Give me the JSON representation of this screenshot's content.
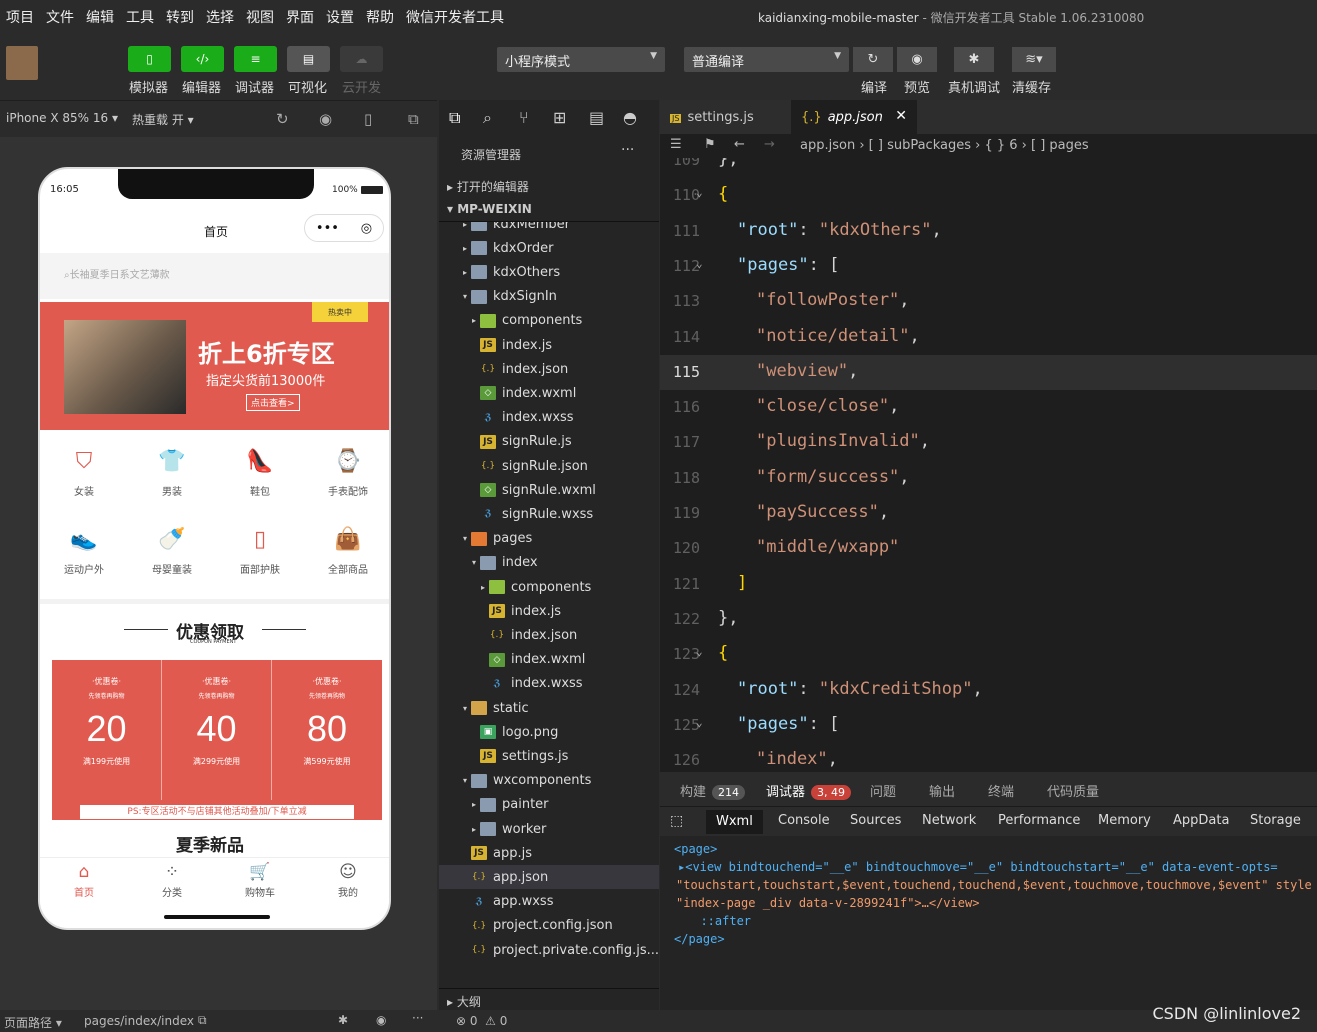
{
  "menu": [
    "项目",
    "文件",
    "编辑",
    "工具",
    "转到",
    "选择",
    "视图",
    "界面",
    "设置",
    "帮助",
    "微信开发者工具"
  ],
  "window_title": {
    "project": "kaidianxing-mobile-master",
    "sep": " - ",
    "app": "微信开发者工具 Stable 1.06.2310080"
  },
  "toolbar": {
    "simulator": "模拟器",
    "editor": "编辑器",
    "debugger": "调试器",
    "visual": "可视化",
    "cloud": "云开发",
    "mode_select": "小程序模式",
    "compile_select": "普通编译",
    "compile": "编译",
    "preview": "预览",
    "real_debug": "真机调试",
    "clear_cache": "清缓存"
  },
  "simbar": {
    "device": "iPhone X 85% 16",
    "hot_reload": "热重载 开"
  },
  "phone": {
    "time": "16:05",
    "battery": "100%",
    "page_title": "首页",
    "search_placeholder": "长袖夏季日系文艺薄款",
    "banner": {
      "tag": "热卖中",
      "title": "折上6折专区",
      "subtitle": "指定尖货前13000件",
      "button": "点击查看>"
    },
    "categories": [
      {
        "icon": "skirt-icon",
        "label": "女装"
      },
      {
        "icon": "shirt-icon",
        "label": "男装"
      },
      {
        "icon": "heel-icon",
        "label": "鞋包"
      },
      {
        "icon": "watch-icon",
        "label": "手表配饰"
      },
      {
        "icon": "sneaker-icon",
        "label": "运动户外"
      },
      {
        "icon": "bottle-icon",
        "label": "母婴童装"
      },
      {
        "icon": "cosmetic-icon",
        "label": "面部护肤"
      },
      {
        "icon": "bag-icon",
        "label": "全部商品"
      }
    ],
    "coupon_title": "优惠领取",
    "coupon_sub": "COUPON PAYMENT",
    "coupons": [
      {
        "tag": "·优惠卷·",
        "desc": "先领卷再购物",
        "value": "20",
        "cond": "满199元使用"
      },
      {
        "tag": "·优惠卷·",
        "desc": "先领卷再购物",
        "value": "40",
        "cond": "满299元使用"
      },
      {
        "tag": "·优惠卷·",
        "desc": "先领卷再购物",
        "value": "80",
        "cond": "满599元使用"
      }
    ],
    "coupon_note": "PS:专区活动不与店铺其他活动叠加/下单立减",
    "new_title": "夏季新品",
    "tabbar": [
      {
        "icon": "home-icon",
        "label": "首页"
      },
      {
        "icon": "category-icon",
        "label": "分类"
      },
      {
        "icon": "cart-icon",
        "label": "购物车"
      },
      {
        "icon": "user-icon",
        "label": "我的"
      }
    ]
  },
  "explorer": {
    "title": "资源管理器",
    "open_editors": "打开的编辑器",
    "root": "MP-WEIXIN",
    "outline": "大纲",
    "tree": [
      {
        "d": 1,
        "arr": "▸",
        "type": "folder",
        "name": "kdxMember"
      },
      {
        "d": 1,
        "arr": "▸",
        "type": "folder",
        "name": "kdxOrder"
      },
      {
        "d": 1,
        "arr": "▸",
        "type": "folder",
        "name": "kdxOthers"
      },
      {
        "d": 1,
        "arr": "▾",
        "type": "folder",
        "name": "kdxSignIn"
      },
      {
        "d": 2,
        "arr": "▸",
        "type": "folder green",
        "name": "components"
      },
      {
        "d": 2,
        "arr": "",
        "type": "js",
        "name": "index.js"
      },
      {
        "d": 2,
        "arr": "",
        "type": "json",
        "name": "index.json"
      },
      {
        "d": 2,
        "arr": "",
        "type": "wxml",
        "name": "index.wxml"
      },
      {
        "d": 2,
        "arr": "",
        "type": "wxss",
        "name": "index.wxss"
      },
      {
        "d": 2,
        "arr": "",
        "type": "js",
        "name": "signRule.js"
      },
      {
        "d": 2,
        "arr": "",
        "type": "json",
        "name": "signRule.json"
      },
      {
        "d": 2,
        "arr": "",
        "type": "wxml",
        "name": "signRule.wxml"
      },
      {
        "d": 2,
        "arr": "",
        "type": "wxss",
        "name": "signRule.wxss"
      },
      {
        "d": 1,
        "arr": "▾",
        "type": "folder orange",
        "name": "pages"
      },
      {
        "d": 2,
        "arr": "▾",
        "type": "folder",
        "name": "index"
      },
      {
        "d": 3,
        "arr": "▸",
        "type": "folder green",
        "name": "components"
      },
      {
        "d": 3,
        "arr": "",
        "type": "js",
        "name": "index.js"
      },
      {
        "d": 3,
        "arr": "",
        "type": "json",
        "name": "index.json"
      },
      {
        "d": 3,
        "arr": "",
        "type": "wxml",
        "name": "index.wxml"
      },
      {
        "d": 3,
        "arr": "",
        "type": "wxss",
        "name": "index.wxss"
      },
      {
        "d": 1,
        "arr": "▾",
        "type": "folder yel",
        "name": "static"
      },
      {
        "d": 2,
        "arr": "",
        "type": "png",
        "name": "logo.png"
      },
      {
        "d": 2,
        "arr": "",
        "type": "js",
        "name": "settings.js"
      },
      {
        "d": 1,
        "arr": "▾",
        "type": "folder",
        "name": "wxcomponents"
      },
      {
        "d": 2,
        "arr": "▸",
        "type": "folder",
        "name": "painter"
      },
      {
        "d": 2,
        "arr": "▸",
        "type": "folder",
        "name": "worker"
      },
      {
        "d": 1,
        "arr": "",
        "type": "js",
        "name": "app.js"
      },
      {
        "d": 1,
        "arr": "",
        "type": "json",
        "name": "app.json",
        "selected": true
      },
      {
        "d": 1,
        "arr": "",
        "type": "wxss",
        "name": "app.wxss"
      },
      {
        "d": 1,
        "arr": "",
        "type": "json",
        "name": "project.config.json"
      },
      {
        "d": 1,
        "arr": "",
        "type": "json",
        "name": "project.private.config.js..."
      }
    ]
  },
  "editor": {
    "tabs": [
      {
        "name": "settings.js",
        "icon": "JS"
      },
      {
        "name": "app.json",
        "icon": "{ }",
        "active": true
      }
    ],
    "breadcrumb": [
      "app.json",
      "[ ] subPackages",
      "{ } 6",
      "[ ] pages"
    ],
    "lines": [
      {
        "n": "109",
        "indent": 2,
        "text": "},",
        "cls": "p"
      },
      {
        "n": "110",
        "indent": 2,
        "text": "{",
        "cls": "br",
        "fold": true
      },
      {
        "n": "111",
        "indent": 3,
        "key": "\"root\"",
        "val": "\"kdxOthers\"",
        "tail": ","
      },
      {
        "n": "112",
        "indent": 3,
        "key": "\"pages\"",
        "tail": ": [",
        "fold": true
      },
      {
        "n": "113",
        "indent": 4,
        "val": "\"followPoster\"",
        "tail": ","
      },
      {
        "n": "114",
        "indent": 4,
        "val": "\"notice/detail\"",
        "tail": ","
      },
      {
        "n": "115",
        "indent": 4,
        "val": "\"webview\"",
        "tail": ",",
        "current": true
      },
      {
        "n": "116",
        "indent": 4,
        "val": "\"close/close\"",
        "tail": ","
      },
      {
        "n": "117",
        "indent": 4,
        "val": "\"pluginsInvalid\"",
        "tail": ","
      },
      {
        "n": "118",
        "indent": 4,
        "val": "\"form/success\"",
        "tail": ","
      },
      {
        "n": "119",
        "indent": 4,
        "val": "\"paySuccess\"",
        "tail": ","
      },
      {
        "n": "120",
        "indent": 4,
        "val": "\"middle/wxapp\"",
        "tail": ""
      },
      {
        "n": "121",
        "indent": 3,
        "text": "]",
        "cls": "br"
      },
      {
        "n": "122",
        "indent": 2,
        "text": "},",
        "cls": "p"
      },
      {
        "n": "123",
        "indent": 2,
        "text": "{",
        "cls": "br",
        "fold": true
      },
      {
        "n": "124",
        "indent": 3,
        "key": "\"root\"",
        "val": "\"kdxCreditShop\"",
        "tail": ","
      },
      {
        "n": "125",
        "indent": 3,
        "key": "\"pages\"",
        "tail": ": [",
        "fold": true
      },
      {
        "n": "126",
        "indent": 4,
        "val": "\"index\"",
        "tail": ","
      }
    ]
  },
  "devtools": {
    "top_tabs": [
      {
        "label": "构建",
        "badge": "214"
      },
      {
        "label": "调试器",
        "badge": "3, 49",
        "active": true
      },
      {
        "label": "问题"
      },
      {
        "label": "输出"
      },
      {
        "label": "终端"
      },
      {
        "label": "代码质量"
      }
    ],
    "panels": [
      "Wxml",
      "Console",
      "Sources",
      "Network",
      "Performance",
      "Memory",
      "AppData",
      "Storage"
    ],
    "dom_lines": [
      "<page>",
      "▸<view bindtouchend=\"__e\" bindtouchmove=\"__e\" bindtouchstart=\"__e\" data-event-opts=",
      "\"touchstart,touchstart,$event,touchend,touchend,$event,touchmove,touchmove,$event\" style",
      "\"index-page _div data-v-2899241f\">…</view>",
      "  ::after",
      "</page>"
    ]
  },
  "status": {
    "path_label": "页面路径",
    "path": "pages/index/index",
    "errors": "0",
    "warnings": "0"
  },
  "watermark": "CSDN @linlinlove2"
}
